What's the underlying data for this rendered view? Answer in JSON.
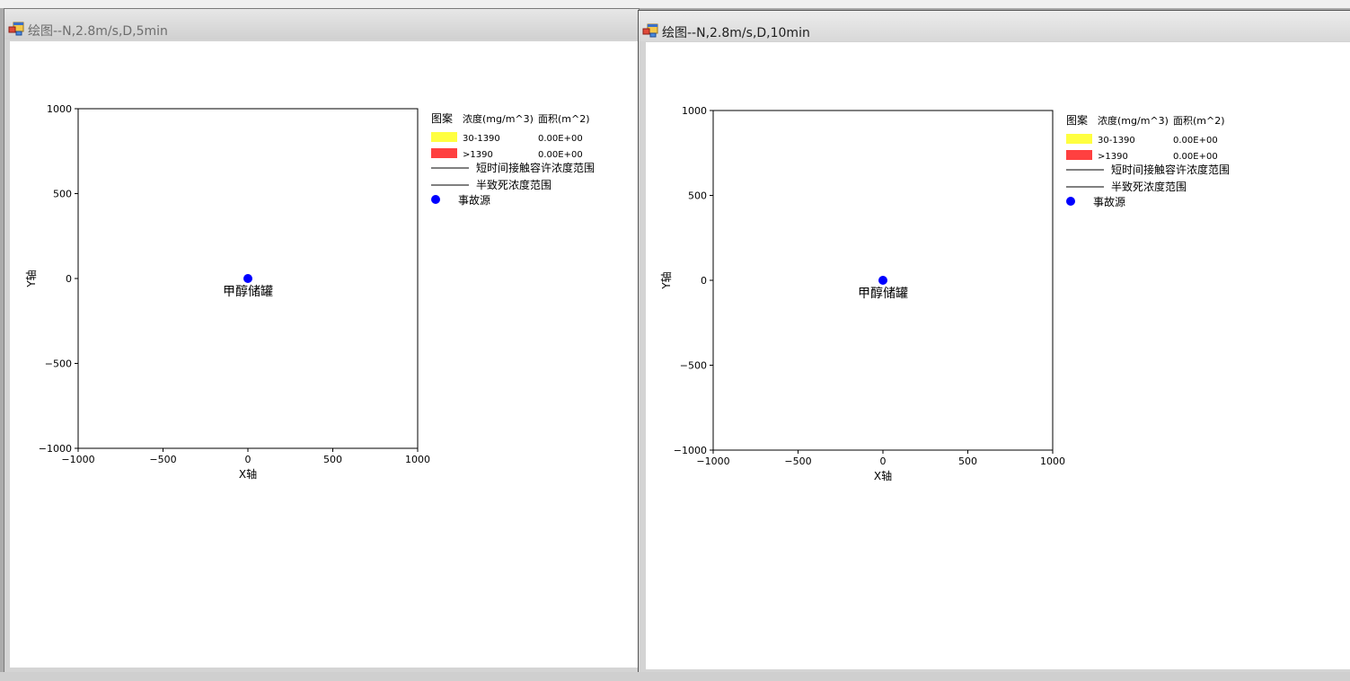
{
  "windows": [
    {
      "title": "绘图--N,2.8m/s,D,5min",
      "icon": "app-form-icon",
      "chart_data": {
        "type": "scatter",
        "xlabel": "X轴",
        "ylabel": "Y轴",
        "xlim": [
          -1000,
          1000
        ],
        "ylim": [
          -1000,
          1000
        ],
        "x_ticks": [
          "−1000",
          "−500",
          "0",
          "500",
          "1000"
        ],
        "y_ticks": [
          "1000",
          "500",
          "0",
          "−500",
          "−1000"
        ],
        "points": [
          {
            "x": 0,
            "y": 0,
            "label": "甲醇储罐",
            "color": "#0000ff"
          }
        ],
        "legend": {
          "header": [
            "图案",
            "浓度(mg/m^3)",
            "面积(m^2)"
          ],
          "ranges": [
            {
              "color": "#ffff40",
              "range": "30-1390",
              "area": "0.00E+00"
            },
            {
              "color": "#ff4040",
              "range": ">1390",
              "area": "0.00E+00"
            }
          ],
          "lines": [
            "短时间接触容许浓度范围",
            "半致死浓度范围"
          ],
          "marker": "事故源"
        }
      }
    },
    {
      "title": "绘图--N,2.8m/s,D,10min",
      "icon": "app-form-icon",
      "chart_data": {
        "type": "scatter",
        "xlabel": "X轴",
        "ylabel": "Y轴",
        "xlim": [
          -1000,
          1000
        ],
        "ylim": [
          -1000,
          1000
        ],
        "x_ticks": [
          "−1000",
          "−500",
          "0",
          "500",
          "1000"
        ],
        "y_ticks": [
          "1000",
          "500",
          "0",
          "−500",
          "−1000"
        ],
        "points": [
          {
            "x": 0,
            "y": 0,
            "label": "甲醇储罐",
            "color": "#0000ff"
          }
        ],
        "legend": {
          "header": [
            "图案",
            "浓度(mg/m^3)",
            "面积(m^2)"
          ],
          "ranges": [
            {
              "color": "#ffff40",
              "range": "30-1390",
              "area": "0.00E+00"
            },
            {
              "color": "#ff4040",
              "range": ">1390",
              "area": "0.00E+00"
            }
          ],
          "lines": [
            "短时间接触容许浓度范围",
            "半致死浓度范围"
          ],
          "marker": "事故源"
        }
      }
    }
  ]
}
